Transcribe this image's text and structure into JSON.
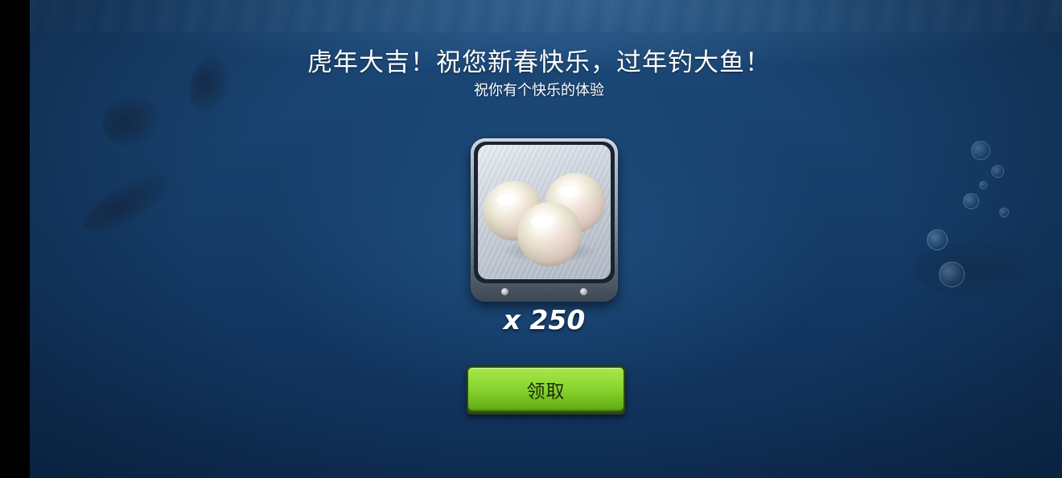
{
  "popup": {
    "title": "虎年大吉！祝您新春快乐，过年钓大鱼！",
    "subtitle": "祝你有个快乐的体验"
  },
  "reward": {
    "item_icon": "pearls-icon",
    "amount_label": "x 250",
    "amount": 250
  },
  "actions": {
    "claim_label": "领取",
    "claim_color": "#8ad631"
  },
  "theme": {
    "background": "#173f6b"
  }
}
